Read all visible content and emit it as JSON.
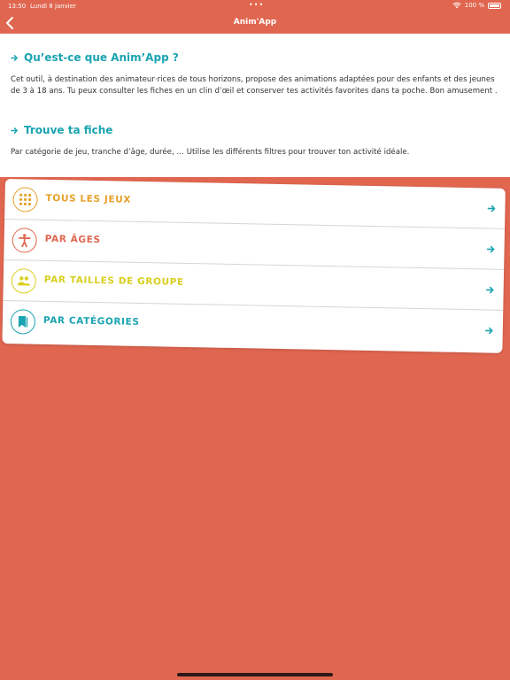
{
  "status": {
    "time": "13:50",
    "date": "Lundi 8 janvier",
    "dots": "•••",
    "battery": "100 %"
  },
  "nav": {
    "title": "Anim'App"
  },
  "intro": {
    "title": "Qu’est-ce que Anim’App ?",
    "text": "Cet outil, à destination des animateur·rices de tous horizons, propose des animations adaptées pour des enfants et des jeunes de 3 à 18 ans. Tu peux consulter les fiches en un clin d’œil et conserver tes activités favorites dans ta poche. Bon amusement ."
  },
  "find": {
    "title": "Trouve ta fiche",
    "text": "Par catégorie de jeu, tranche d’âge, durée, … Utilise les différents filtres pour trouver ton activité idéale."
  },
  "menu": {
    "items": [
      {
        "label": "TOUS LES JEUX",
        "icon": "grid-icon",
        "color": "#e6a12a"
      },
      {
        "label": "PAR ÂGES",
        "icon": "person-icon",
        "color": "#e06650"
      },
      {
        "label": "PAR TAILLES DE GROUPE",
        "icon": "group-icon",
        "color": "#d9cf1f"
      },
      {
        "label": "PAR CATÉGORIES",
        "icon": "bookmark-icon",
        "color": "#1aa4b1"
      }
    ]
  },
  "colors": {
    "background": "#e06650",
    "accent": "#1aa4b1",
    "text": "#333333"
  }
}
